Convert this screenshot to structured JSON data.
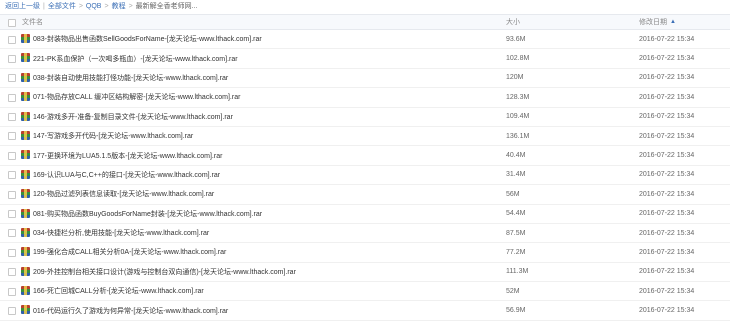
{
  "breadcrumb": {
    "back": "返回上一级",
    "all_files": "全部文件",
    "level1": "QQB",
    "level2": "教程",
    "current": "最新解全香老师网..."
  },
  "columns": {
    "name": "文件名",
    "size": "大小",
    "date": "修改日期",
    "sort_icon": "sort-up-icon"
  },
  "files": [
    {
      "name": "083-封装物品出售函数SellGoodsForName-[龙天论坛-www.lthack.com].rar",
      "size": "93.6M",
      "date": "2016-07-22 15:34"
    },
    {
      "name": "221-PK系血保护（一次喝多瓶血）-[龙天论坛-www.lthack.com].rar",
      "size": "102.8M",
      "date": "2016-07-22 15:34"
    },
    {
      "name": "038-封装自动使用技能打怪功能-[龙天论坛-www.lthack.com].rar",
      "size": "120M",
      "date": "2016-07-22 15:34"
    },
    {
      "name": "071-物品存放CALL 缓冲区结构解密-[龙天论坛-www.lthack.com].rar",
      "size": "128.3M",
      "date": "2016-07-22 15:34"
    },
    {
      "name": "146-游戏多开-准备-复制目录文件-[龙天论坛-www.lthack.com].rar",
      "size": "109.4M",
      "date": "2016-07-22 15:34"
    },
    {
      "name": "147-写游戏多开代码-[龙天论坛-www.lthack.com].rar",
      "size": "136.1M",
      "date": "2016-07-22 15:34"
    },
    {
      "name": "177-更换环境为LUA5.1.5版本-[龙天论坛-www.lthack.com].rar",
      "size": "40.4M",
      "date": "2016-07-22 15:34"
    },
    {
      "name": "169-认识LUA与C,C++的接口-[龙天论坛-www.lthack.com].rar",
      "size": "31.4M",
      "date": "2016-07-22 15:34"
    },
    {
      "name": "120-物品过滤列表信息读取-[龙天论坛-www.lthack.com].rar",
      "size": "56M",
      "date": "2016-07-22 15:34"
    },
    {
      "name": "081-购买物品函数BuyGoodsForName封装-[龙天论坛-www.lthack.com].rar",
      "size": "54.4M",
      "date": "2016-07-22 15:34"
    },
    {
      "name": "034-快捷栏分析,使用技能-[龙天论坛-www.lthack.com].rar",
      "size": "87.5M",
      "date": "2016-07-22 15:34"
    },
    {
      "name": "199-强化合成CALL相关分析0A-[龙天论坛-www.lthack.com].rar",
      "size": "77.2M",
      "date": "2016-07-22 15:34"
    },
    {
      "name": "209-外挂控制台相关接口设计(游戏与控制台双向通信)-[龙天论坛-www.lthack.com].rar",
      "size": "111.3M",
      "date": "2016-07-22 15:34"
    },
    {
      "name": "166-死亡回城CALL分析-[龙天论坛-www.lthack.com].rar",
      "size": "52M",
      "date": "2016-07-22 15:34"
    },
    {
      "name": "016-代码运行久了游戏为何异常-[龙天论坛-www.lthack.com].rar",
      "size": "56.9M",
      "date": "2016-07-22 15:34"
    }
  ]
}
